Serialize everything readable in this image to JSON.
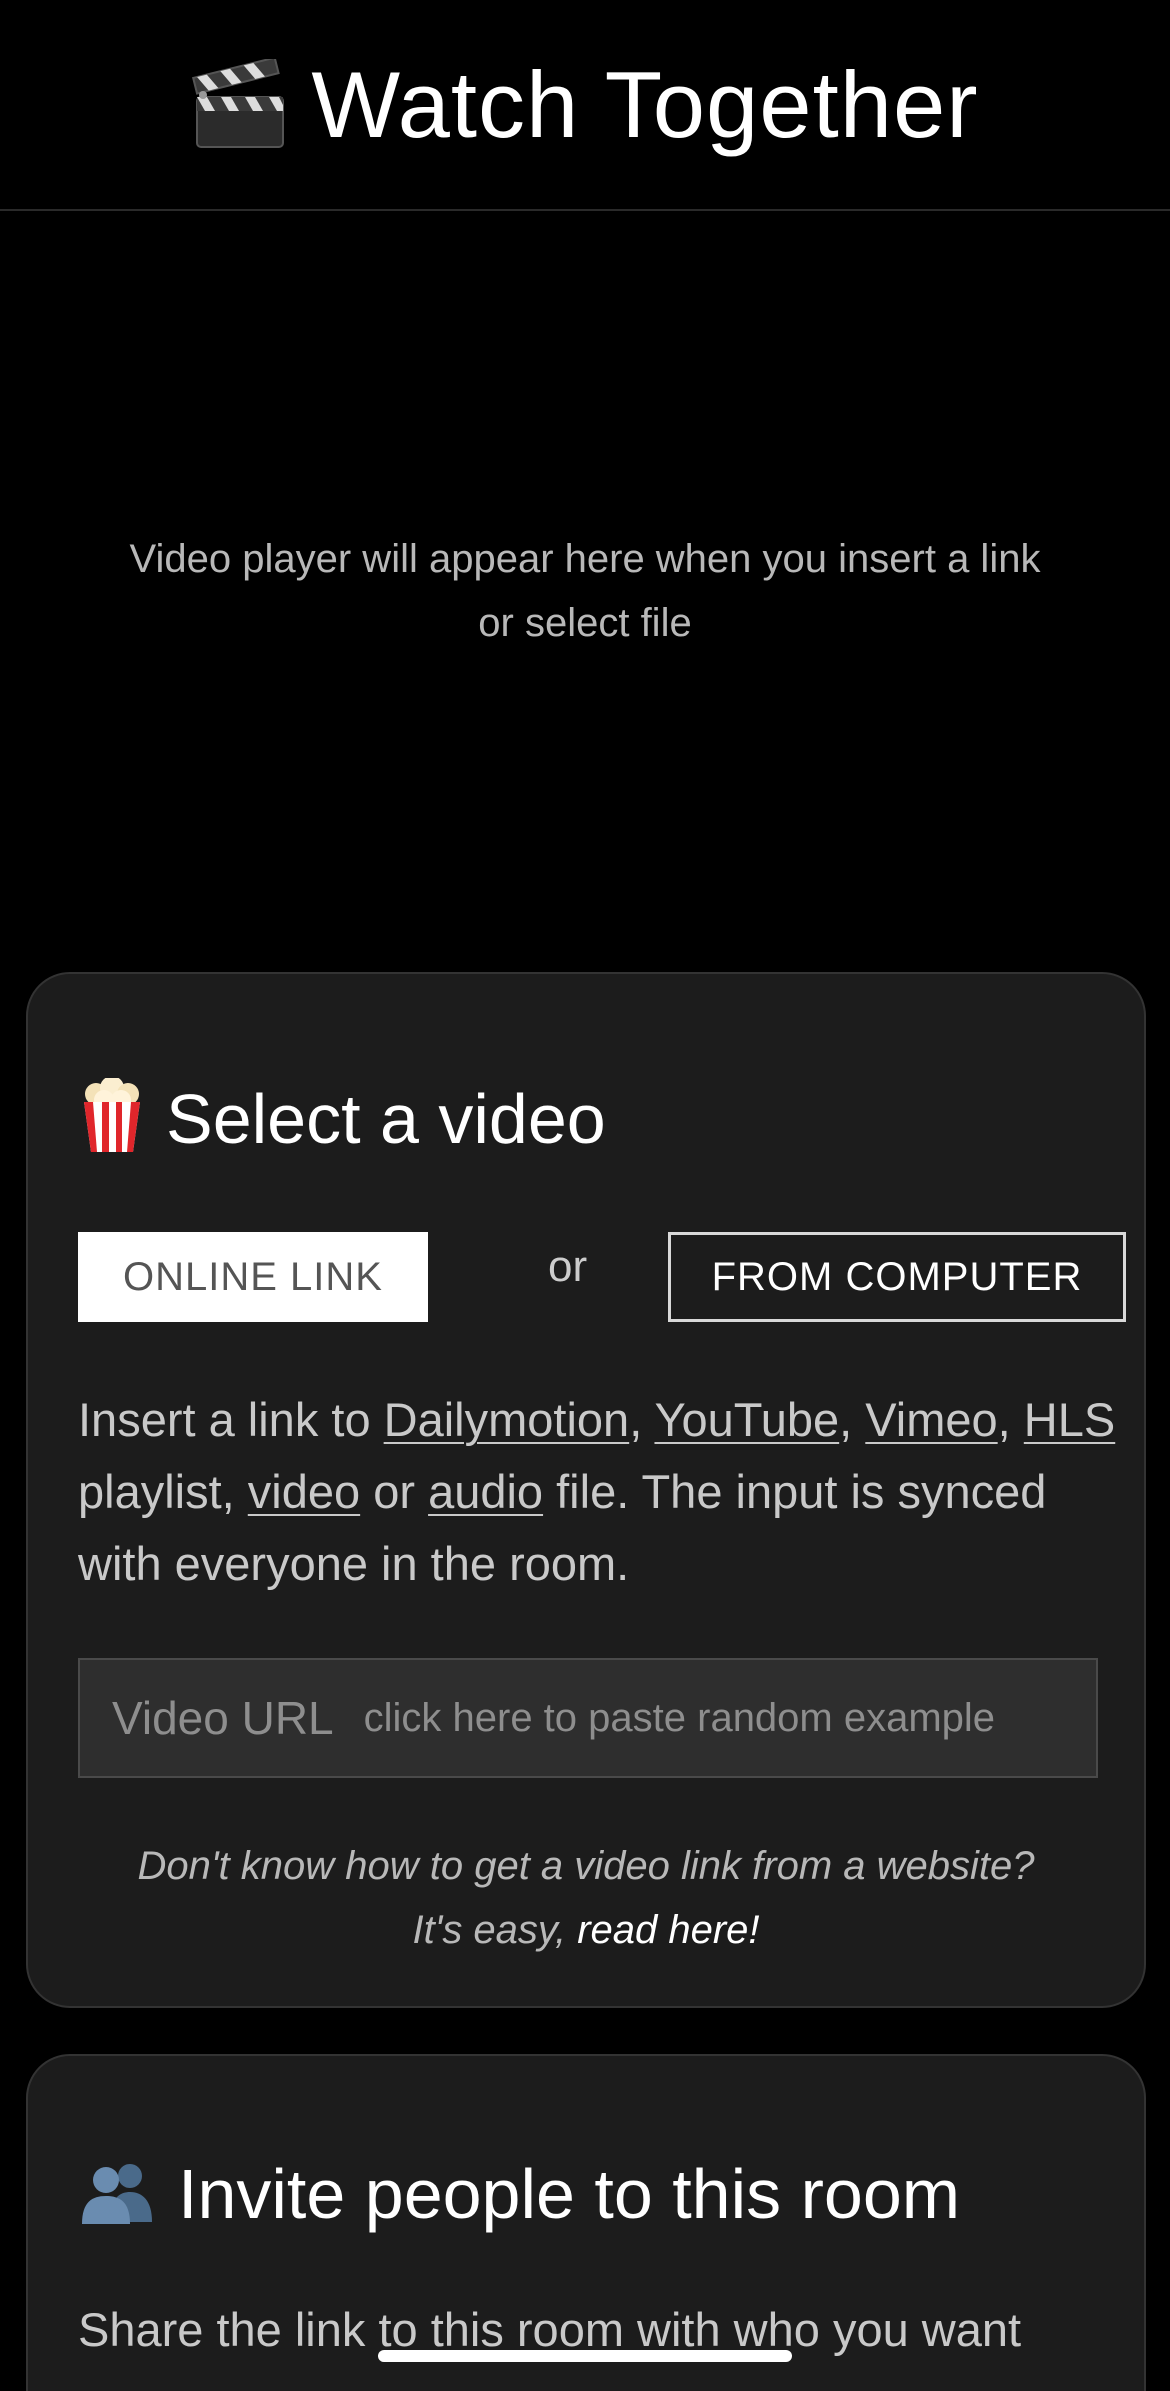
{
  "header": {
    "title": "Watch Together",
    "icon": "clapperboard-icon"
  },
  "player": {
    "placeholder": "Video player will appear here when you insert a link or select file"
  },
  "select_card": {
    "icon": "popcorn-icon",
    "title": "Select a video",
    "tabs": {
      "online": "ONLINE LINK",
      "or": "or",
      "computer": "FROM COMPUTER",
      "active": "online"
    },
    "description": {
      "prefix": "Insert a link to ",
      "links": [
        "Dailymotion",
        "YouTube",
        "Vimeo",
        "HLS",
        "video",
        "audio"
      ],
      "sep1": ", ",
      "sep2": ", ",
      "sep3": ", ",
      "after_hls": " playlist, ",
      "after_video": " or ",
      "suffix": " file. The input is synced with everyone in the room."
    },
    "url_input": {
      "label": "Video URL",
      "placeholder": "click here to paste random example",
      "value": ""
    },
    "help": {
      "line1": "Don't know how to get a video link from a website?",
      "line2_prefix": "It's easy, ",
      "line2_link": "read here!"
    }
  },
  "invite_card": {
    "icon": "people-icon",
    "title": "Invite people to this room",
    "description": "Share the link to this room with who you want"
  },
  "colors": {
    "background": "#000000",
    "card": "#1c1c1c",
    "input": "#2e2e2e",
    "text_muted": "#b8b8b8"
  }
}
